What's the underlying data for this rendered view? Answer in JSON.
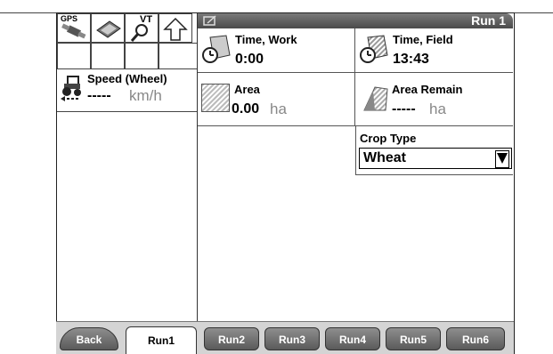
{
  "status_icons": {
    "gps_label": "GPS",
    "vt_label": "VT"
  },
  "speed": {
    "label": "Speed (Wheel)",
    "value": "-----",
    "unit": "km/h"
  },
  "header": {
    "title": "Run 1"
  },
  "time_work": {
    "label": "Time, Work",
    "value": "0:00"
  },
  "time_field": {
    "label": "Time, Field",
    "value": "13:43"
  },
  "area": {
    "label": "Area",
    "value": "0.00",
    "unit": "ha"
  },
  "area_remain": {
    "label": "Area Remain",
    "value": "-----",
    "unit": "ha"
  },
  "crop_type": {
    "label": "Crop Type",
    "value": "Wheat"
  },
  "buttons": {
    "back": "Back",
    "run1": "Run1",
    "run2": "Run2",
    "run3": "Run3",
    "run4": "Run4",
    "run5": "Run5",
    "run6": "Run6"
  },
  "icons": {
    "gps": "gps-antenna-icon",
    "diagnostics": "diagnostics-icon",
    "vt": "vt-search-icon",
    "up": "up-arrow-icon",
    "tractor": "tractor-icon",
    "time_work": "stopwatch-field-icon",
    "time_field": "clock-field-icon",
    "area": "hatched-area-icon",
    "area_remain": "hatched-area-remain-icon",
    "title": "edit-icon"
  }
}
